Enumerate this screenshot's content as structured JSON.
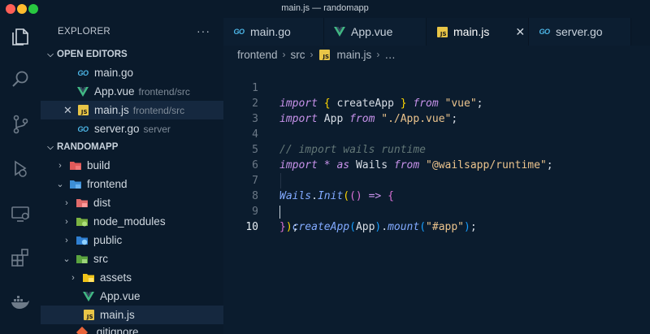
{
  "window": {
    "title": "main.js — randomapp"
  },
  "activity_bar": {
    "icons": [
      "files-icon",
      "search-icon",
      "source-control-icon",
      "run-debug-icon",
      "remote-explorer-icon",
      "extensions-icon",
      "docker-icon"
    ]
  },
  "explorer": {
    "header": "EXPLORER",
    "more": "···",
    "open_editors": {
      "title": "OPEN EDITORS",
      "items": [
        {
          "name": "main.go",
          "desc": "",
          "icon": "go"
        },
        {
          "name": "App.vue",
          "desc": "frontend/src",
          "icon": "vue"
        },
        {
          "name": "main.js",
          "desc": "frontend/src",
          "icon": "js"
        },
        {
          "name": "server.go",
          "desc": "server",
          "icon": "go"
        }
      ]
    },
    "project": {
      "title": "RANDOMAPP",
      "items": [
        {
          "name": "build",
          "icon": "folder-build",
          "expanded": false
        },
        {
          "name": "frontend",
          "icon": "folder-frontend",
          "expanded": true
        },
        {
          "name": "dist",
          "icon": "folder-dist",
          "expanded": false
        },
        {
          "name": "node_modules",
          "icon": "folder-node",
          "expanded": false
        },
        {
          "name": "public",
          "icon": "folder-public",
          "expanded": false
        },
        {
          "name": "src",
          "icon": "folder-src",
          "expanded": true
        },
        {
          "name": "assets",
          "icon": "folder-assets",
          "expanded": false
        },
        {
          "name": "App.vue",
          "icon": "vue"
        },
        {
          "name": "main.js",
          "icon": "js"
        },
        {
          "name": ".gitignore",
          "icon": "git"
        }
      ]
    }
  },
  "tabs": [
    {
      "label": "main.go",
      "icon": "go",
      "active": false
    },
    {
      "label": "App.vue",
      "icon": "vue",
      "active": false
    },
    {
      "label": "main.js",
      "icon": "js",
      "active": true
    },
    {
      "label": "server.go",
      "icon": "go",
      "active": false
    }
  ],
  "breadcrumb": [
    "frontend",
    "src",
    "main.js",
    "…"
  ],
  "code": {
    "current_line": 10,
    "lines": [
      {
        "n": "1"
      },
      {
        "n": "2"
      },
      {
        "n": "3"
      },
      {
        "n": "4"
      },
      {
        "n": "5"
      },
      {
        "n": "6"
      },
      {
        "n": "7"
      },
      {
        "n": "8"
      },
      {
        "n": "9"
      },
      {
        "n": "10"
      }
    ],
    "tokens": {
      "import": "import",
      "from": "from",
      "createApp": "createApp",
      "App": "App",
      "vue_str": "\"vue\"",
      "appvue_str": "\"./App.vue\"",
      "comment": "// import wails runtime",
      "star": "*",
      "as": "as",
      "Wails": "Wails",
      "runtime_str": "\"@wailsapp/runtime\"",
      "Init": "Init",
      "arrow": "=>",
      "mount": "mount",
      "app_sel": "\"#app\""
    }
  },
  "colors": {
    "background": "#0b1c2e",
    "sidebar": "#0a1a2b",
    "keyword": "#c792ea",
    "string": "#ecc48d",
    "function": "#82aaff",
    "comment": "#637777",
    "go": "#4db7e8",
    "vue": "#41b883",
    "js": "#e8c547"
  }
}
